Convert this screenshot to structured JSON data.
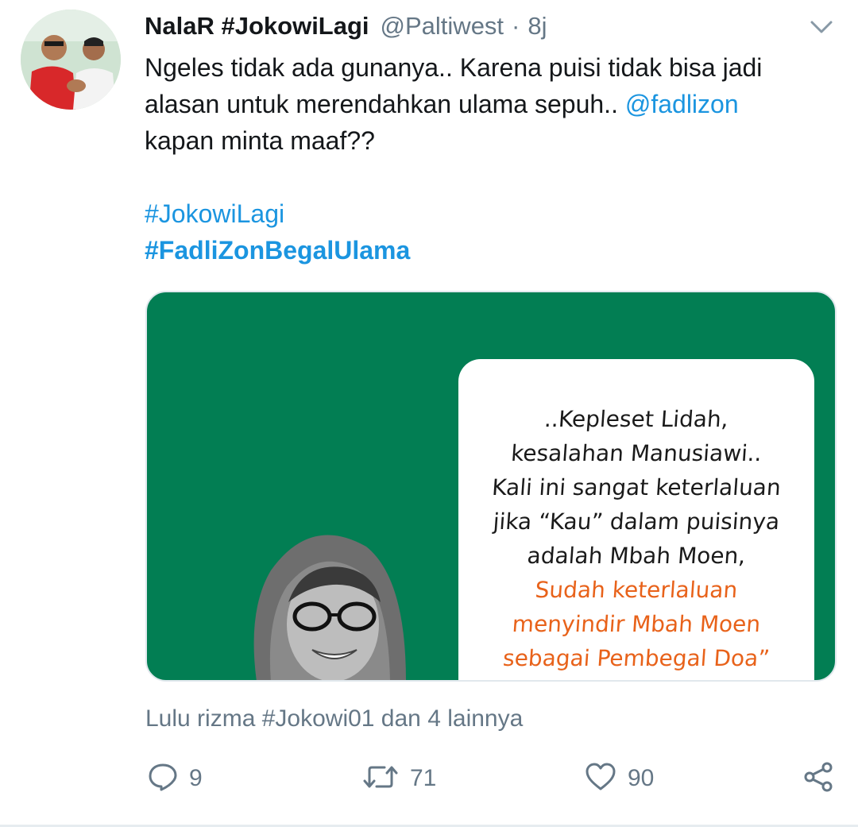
{
  "tweet": {
    "display_name": "NalaR #JokowiLagi",
    "handle": "@Paltiwest",
    "separator": "·",
    "time": "8j",
    "text": {
      "line1": "Ngeles tidak ada gunanya.. Karena puisi tidak bisa jadi",
      "line2_prefix": "alasan untuk merendahkan ulama sepuh.. ",
      "mention": "@fadlizon",
      "line3": "kapan minta maaf??",
      "hashtag1": "#JokowiLagi",
      "hashtag2": "#FadliZonBegalUlama"
    },
    "media": {
      "quote_lines": [
        "..Kepleset Lidah,",
        "kesalahan Manusiawi..",
        "Kali ini sangat keterlaluan",
        "jika “Kau” dalam puisinya",
        "adalah Mbah Moen,",
        "Sudah keterlaluan",
        "menyindir Mbah Moen",
        "sebagai Pembegal Doa”"
      ]
    },
    "likers": "Lulu rizma #Jokowi01 dan 4 lainnya",
    "actions": {
      "reply_count": "9",
      "retweet_count": "71",
      "like_count": "90"
    }
  },
  "colors": {
    "link": "#1b95e0",
    "secondary_text": "#657786",
    "media_green": "#027e53",
    "quote_orange": "#e8621a"
  },
  "icons": [
    "avatar",
    "chevron-down-icon",
    "reply-icon",
    "retweet-icon",
    "like-icon",
    "share-icon"
  ]
}
